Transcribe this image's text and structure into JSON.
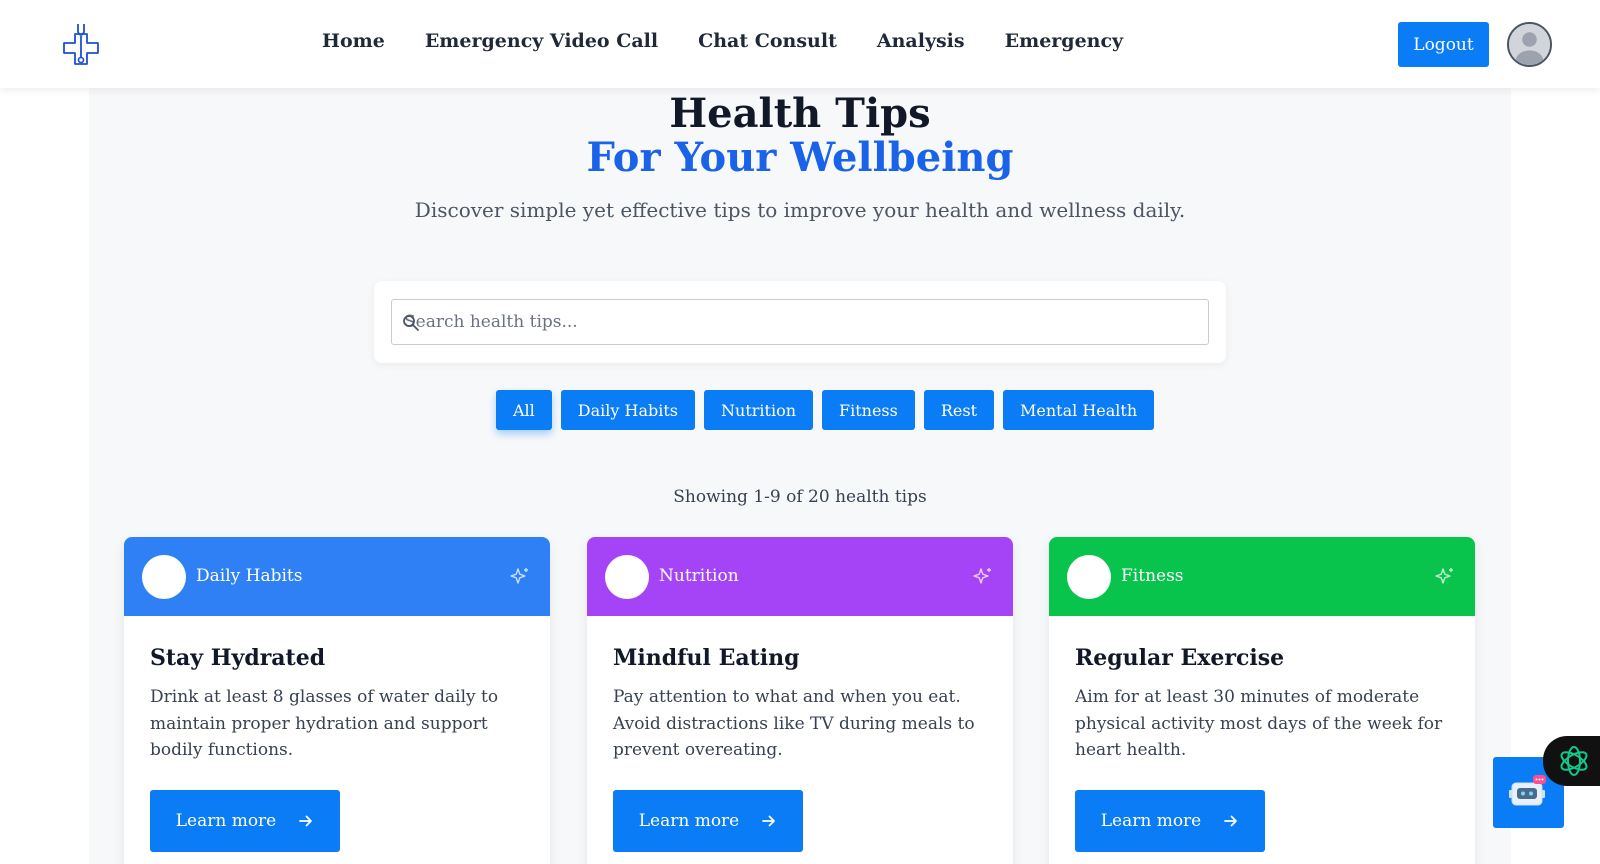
{
  "nav": {
    "links": [
      "Home",
      "Emergency Video Call",
      "Chat Consult",
      "Analysis",
      "Emergency"
    ],
    "logout_label": "Logout",
    "logo_icon": "medical-cross-stethoscope-icon",
    "avatar_icon": "user-avatar-icon"
  },
  "hero": {
    "title_line1": "Health Tips",
    "title_line2": "For Your Wellbeing",
    "subtitle": "Discover simple yet effective tips to improve your health and wellness daily."
  },
  "search": {
    "placeholder": "Search health tips...",
    "value": ""
  },
  "filters": {
    "items": [
      "All",
      "Daily Habits",
      "Nutrition",
      "Fitness",
      "Rest",
      "Mental Health"
    ],
    "active": "All"
  },
  "results": {
    "showing_text": "Showing 1-9 of 20 health tips"
  },
  "cards": [
    {
      "category": "Daily Habits",
      "color": "#2f80f5",
      "title": "Stay Hydrated",
      "description": "Drink at least 8 glasses of water daily to maintain proper hydration and support bodily functions.",
      "button_label": "Learn more"
    },
    {
      "category": "Nutrition",
      "color": "#a544f7",
      "title": "Mindful Eating",
      "description": "Pay attention to what and when you eat. Avoid distractions like TV during meals to prevent overeating.",
      "button_label": "Learn more"
    },
    {
      "category": "Fitness",
      "color": "#08c44c",
      "title": "Regular Exercise",
      "description": "Aim for at least 30 minutes of moderate physical activity most days of the week for heart health.",
      "button_label": "Learn more"
    }
  ],
  "colors": {
    "primary": "#0a7cf5",
    "title_blue": "#1a63e8"
  }
}
